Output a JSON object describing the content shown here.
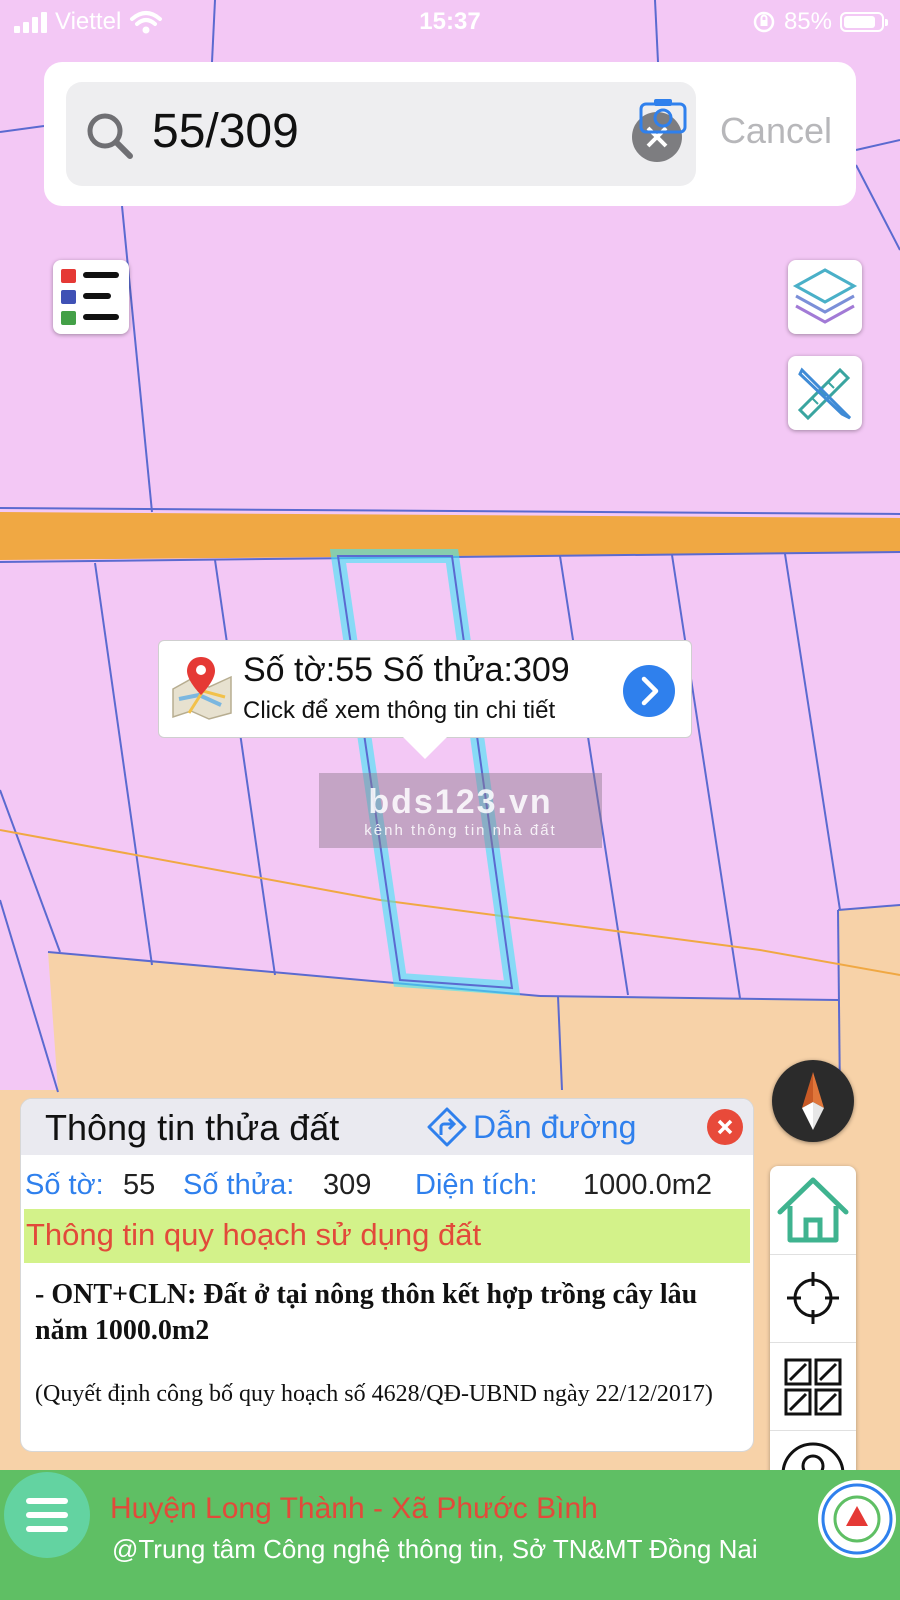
{
  "status_bar": {
    "carrier": "Viettel",
    "time": "15:37",
    "battery": "85%",
    "battery_level": 0.85
  },
  "search": {
    "query": "55/309",
    "cancel_label": "Cancel"
  },
  "popup": {
    "title": "Số tờ:55 Số thửa:309",
    "subtitle": "Click để xem thông tin chi tiết"
  },
  "watermark": {
    "brand": "bds123.vn",
    "tagline": "kênh thông tin nhà đất"
  },
  "info_panel": {
    "title": "Thông tin thửa đất",
    "directions_label": "Dẫn đường",
    "sheet_label": "Số tờ:",
    "sheet_value": "55",
    "parcel_label": "Số thửa:",
    "parcel_value": "309",
    "area_label": "Diện tích:",
    "area_value": "1000.0m2",
    "section_title": "Thông tin quy hoạch sử dụng đất",
    "land_use": "- ONT+CLN: Đất ở tại nông thôn kết hợp trồng cây lâu năm 1000.0m2",
    "decision_note": "(Quyết định công bố quy hoạch số 4628/QĐ-UBND ngày 22/12/2017)"
  },
  "bottom_bar": {
    "location": "Huyện Long Thành - Xã Phước Bình",
    "credit": "@Trung tâm Công nghệ thông tin, Sở TN&MT Đồng Nai"
  },
  "colors": {
    "map_residential": "#f3c8f5",
    "map_agricultural": "#f7d2a8",
    "road": "#f0a843",
    "parcel_border": "#5b6ad0",
    "selected_parcel": "#41e6f6",
    "accent_blue": "#2f80ed",
    "bottom_bar": "#5fbf64",
    "planning_band": "#d3f28a",
    "warning_red": "#e24a3a"
  }
}
